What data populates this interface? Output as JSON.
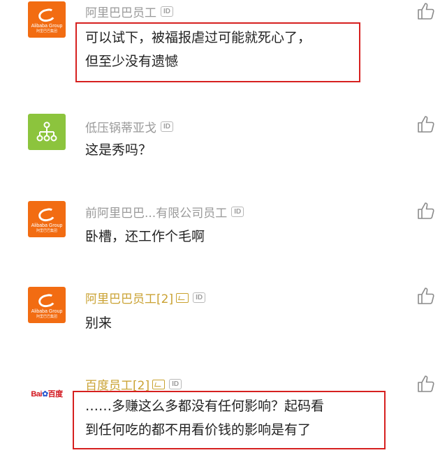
{
  "id_badge_text": "ID",
  "colors": {
    "accent_red_box": "#d6201f",
    "alibaba_orange": "#f26c12",
    "vip_gold": "#caa233"
  },
  "comments": [
    {
      "avatar": {
        "type": "alibaba",
        "text": "Alibaba Group",
        "subtext": "阿里巴巴集团"
      },
      "username": "阿里巴巴员工",
      "level": "",
      "lines": [
        "可以试下，被福报虐过可能就死心了，",
        "但至少没有遗憾"
      ],
      "highlighted": true,
      "like_icon": "thumbs-up-icon"
    },
    {
      "avatar": {
        "type": "org-chart-icon"
      },
      "username": "低压锅蒂亚戈",
      "level": "",
      "lines": [
        "这是秀吗？"
      ],
      "highlighted": false,
      "like_icon": "thumbs-up-icon"
    },
    {
      "avatar": {
        "type": "alibaba",
        "text": "Alibaba Group",
        "subtext": "阿里巴巴集团"
      },
      "username": "前阿里巴巴...有限公司员工",
      "level": "",
      "lines": [
        "卧槽，还工作个毛啊"
      ],
      "highlighted": false,
      "like_icon": "thumbs-up-icon"
    },
    {
      "avatar": {
        "type": "alibaba",
        "text": "Alibaba Group",
        "subtext": "阿里巴巴集团"
      },
      "username": "阿里巴巴员工[2]",
      "level": "vip",
      "lines": [
        "别来"
      ],
      "highlighted": false,
      "like_icon": "thumbs-up-icon"
    },
    {
      "avatar": {
        "type": "baidu",
        "text": "Bai",
        "mid": "du",
        "tail": "百度"
      },
      "username": "百度员工[2]",
      "level": "vip",
      "lines": [
        "……多赚这么多都没有任何影响？起码看",
        "到任何吃的都不用看价钱的影响是有了"
      ],
      "highlighted": true,
      "like_icon": "thumbs-up-icon"
    }
  ]
}
